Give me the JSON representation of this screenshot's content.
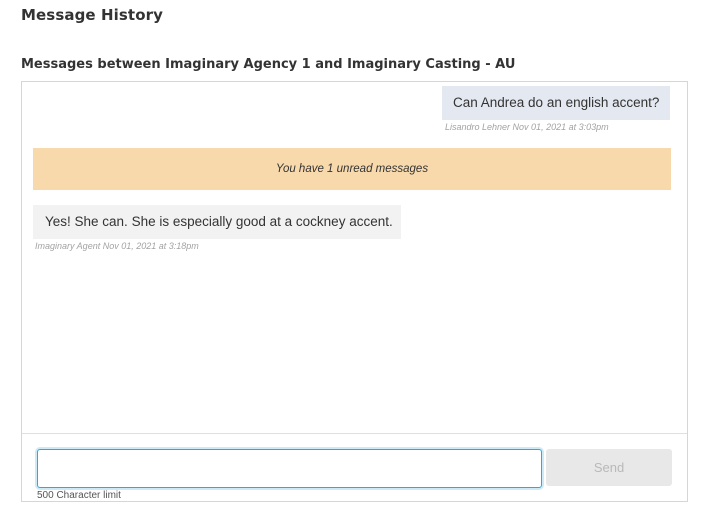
{
  "page": {
    "title": "Message History"
  },
  "thread": {
    "title": "Messages between Imaginary Agency 1 and Imaginary Casting - AU",
    "messages": [
      {
        "direction": "sent",
        "text": "Can Andrea do an english accent?",
        "meta": "Lisandro Lehner Nov 01, 2021 at 3:03pm"
      },
      {
        "direction": "received",
        "text": "Yes! She can. She is especially good at a cockney accent.",
        "meta": "Imaginary Agent Nov 01, 2021 at 3:18pm"
      }
    ],
    "unread_banner": "You have 1 unread messages"
  },
  "compose": {
    "value": "",
    "placeholder": "",
    "send_label": "Send",
    "char_limit_label": "500 Character limit"
  },
  "colors": {
    "sent_bubble": "#e4e8f0",
    "received_bubble": "#f2f2f2",
    "unread_banner": "#f8d9ac",
    "input_focus": "#3aa3d8"
  }
}
